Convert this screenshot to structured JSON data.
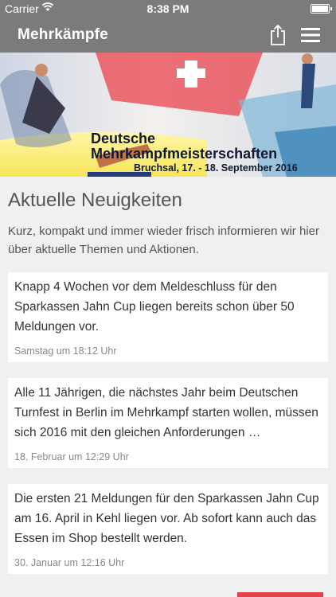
{
  "statusbar": {
    "carrier": "Carrier",
    "time": "8:38 PM"
  },
  "navbar": {
    "title": "Mehrkämpfe"
  },
  "banner": {
    "line1": "Deutsche",
    "line2": "Mehrkampfmeisterschaften",
    "line3": "Bruchsal, 17. - 18. September 2016"
  },
  "main": {
    "heading": "Aktuelle Neuigkeiten",
    "intro": "Kurz, kompakt und immer wieder frisch informieren wir hier über aktuelle Themen und Aktionen.",
    "news": [
      {
        "text": "Knapp 4 Wochen vor dem Meldeschluss für den Sparkassen Jahn Cup liegen bereits schon über 50 Meldungen vor.",
        "date": "Samstag um 18:12 Uhr"
      },
      {
        "text": "Alle 11 Jährigen, die nächstes Jahr beim Deutschen Turnfest in Berlin im Mehrkampf starten wollen, müssen sich 2016 mit den gleichen Anforderungen …",
        "date": "18. Februar um 12:29 Uhr"
      },
      {
        "text": "Die ersten 21 Meldungen für den Sparkassen Jahn Cup am 16. April in Kehl liegen vor. Ab sofort kann auch das Essen im Shop bestellt werden.",
        "date": "30. Januar um 12:16 Uhr"
      }
    ]
  }
}
